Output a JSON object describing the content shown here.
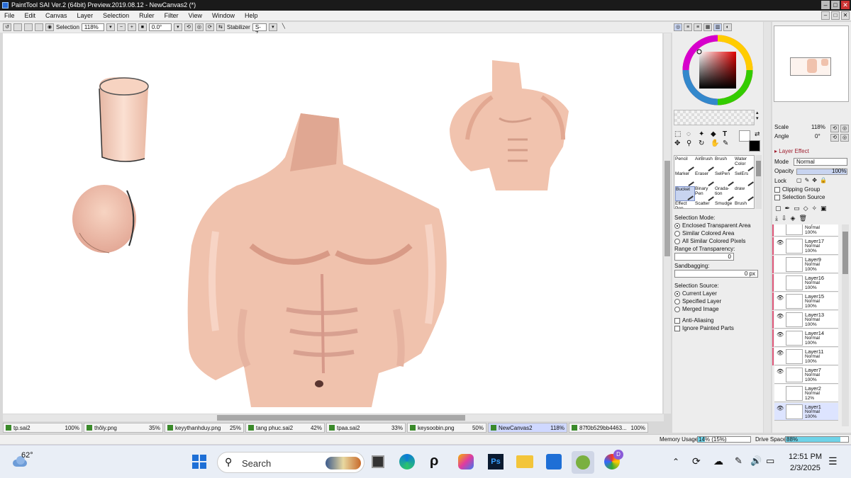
{
  "title": "PaintTool SAI Ver.2 (64bit) Preview.2019.08.12 - NewCanvas2 (*)",
  "menu": [
    "File",
    "Edit",
    "Canvas",
    "Layer",
    "Selection",
    "Ruler",
    "Filter",
    "View",
    "Window",
    "Help"
  ],
  "toolbar": {
    "selection_label": "Selection",
    "zoom": "118%",
    "angle": "0.0°",
    "stabilizer_label": "Stabilizer",
    "stabilizer_value": "S-7"
  },
  "tools": [
    {
      "name": "Pencil",
      "selected": false
    },
    {
      "name": "AirBrush",
      "selected": false
    },
    {
      "name": "Brush",
      "selected": false
    },
    {
      "name": "Water Color",
      "selected": false
    },
    {
      "name": "Marker",
      "selected": false
    },
    {
      "name": "Eraser",
      "selected": false
    },
    {
      "name": "SelPen",
      "selected": false
    },
    {
      "name": "SelErs",
      "selected": false
    },
    {
      "name": "Bucket",
      "selected": true
    },
    {
      "name": "Binary Pen",
      "selected": false
    },
    {
      "name": "Grada- tion",
      "selected": false
    },
    {
      "name": "draw",
      "selected": false
    },
    {
      "name": "Effect Pen",
      "selected": false
    },
    {
      "name": "Scatter",
      "selected": false
    },
    {
      "name": "Smudge",
      "selected": false
    },
    {
      "name": "Brush",
      "selected": false
    }
  ],
  "bucket": {
    "selection_mode_label": "Selection Mode:",
    "selection_modes": [
      "Enclosed Transparent Area",
      "Similar Colored Area",
      "All Similar Colored Pixels"
    ],
    "range_label": "Range of Transparency:",
    "range_value": "0",
    "sandbagging_label": "Sandbagging:",
    "sandbagging_value": "0 px",
    "source_label": "Selection Source:",
    "sources": [
      "Current Layer",
      "Specified Layer",
      "Merged Image"
    ],
    "anti_aliasing": "Anti-Aliasing",
    "ignore_painted": "Ignore Painted Parts"
  },
  "navigator": {
    "scale_label": "Scale",
    "scale_value": "118%",
    "angle_label": "Angle",
    "angle_value": "0°"
  },
  "layer_effect": {
    "header": "Layer Effect",
    "mode_label": "Mode",
    "mode_value": "Normal",
    "opacity_label": "Opacity",
    "opacity_value": "100%",
    "lock_label": "Lock",
    "clipping": "Clipping Group",
    "sel_source": "Selection Source"
  },
  "layers": [
    {
      "name": "Layer18",
      "mode": "Normal",
      "opacity": "100%",
      "visible": false,
      "pink": true,
      "active": false
    },
    {
      "name": "Layer17",
      "mode": "Normal",
      "opacity": "100%",
      "visible": true,
      "pink": true,
      "active": false
    },
    {
      "name": "Layer9",
      "mode": "Normal",
      "opacity": "100%",
      "visible": false,
      "pink": true,
      "active": false
    },
    {
      "name": "Layer16",
      "mode": "Normal",
      "opacity": "100%",
      "visible": false,
      "pink": true,
      "active": false
    },
    {
      "name": "Layer15",
      "mode": "Normal",
      "opacity": "100%",
      "visible": true,
      "pink": true,
      "active": false
    },
    {
      "name": "Layer13",
      "mode": "Normal",
      "opacity": "100%",
      "visible": true,
      "pink": true,
      "active": false
    },
    {
      "name": "Layer14",
      "mode": "Normal",
      "opacity": "100%",
      "visible": true,
      "pink": true,
      "active": false
    },
    {
      "name": "Layer11",
      "mode": "Normal",
      "opacity": "100%",
      "visible": true,
      "pink": true,
      "active": false
    },
    {
      "name": "Layer7",
      "mode": "Normal",
      "opacity": "100%",
      "visible": true,
      "pink": false,
      "active": false
    },
    {
      "name": "Layer2",
      "mode": "Normal",
      "opacity": "12%",
      "visible": false,
      "pink": false,
      "active": false
    },
    {
      "name": "Layer1",
      "mode": "Normal",
      "opacity": "100%",
      "visible": true,
      "pink": false,
      "active": true
    }
  ],
  "tabs": [
    {
      "name": "tp.sai2",
      "pct": "100%",
      "active": false
    },
    {
      "name": "thôly.png",
      "pct": "35%",
      "active": false
    },
    {
      "name": "keyythanhduy.png",
      "pct": "25%",
      "active": false
    },
    {
      "name": "tang phuc.sai2",
      "pct": "42%",
      "active": false
    },
    {
      "name": "tpaa.sai2",
      "pct": "33%",
      "active": false
    },
    {
      "name": "keysoobin.png",
      "pct": "50%",
      "active": false
    },
    {
      "name": "NewCanvas2",
      "pct": "118%",
      "active": true
    },
    {
      "name": "87f0b529bb4463...",
      "pct": "100%",
      "active": false
    }
  ],
  "status": {
    "memory_label": "Memory Usage",
    "memory_value": "14% (15%)",
    "memory_fraction": 0.14,
    "drive_label": "Drive Space",
    "drive_value": "88%",
    "drive_fraction": 0.88
  },
  "taskbar": {
    "weather": "62°",
    "search": "Search",
    "time": "12:51 PM",
    "date": "2/3/2025"
  },
  "colors": {
    "primary": "#000000",
    "secondary": "#ffffff",
    "skin": "#f0c0aa"
  }
}
